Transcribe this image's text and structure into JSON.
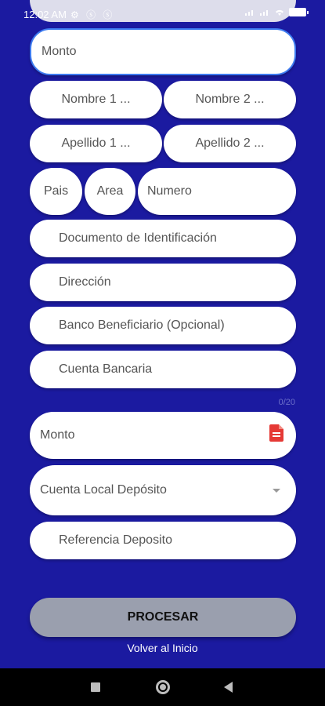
{
  "status_bar": {
    "time": "12:02 AM",
    "left_icons": "⚙ ⓢ ⓢ"
  },
  "form": {
    "monto_top": "Monto",
    "nombre1": "Nombre 1 ...",
    "nombre2": "Nombre 2 ...",
    "apellido1": "Apellido 1 ...",
    "apellido2": "Apellido 2 ...",
    "pais": "Pais",
    "area": "Area",
    "numero": "Numero",
    "documento": "Documento de Identificación",
    "direccion": "Dirección",
    "banco": "Banco Beneficiario (Opcional)",
    "cuenta": "Cuenta Bancaria",
    "counter": "0/20",
    "monto": "Monto",
    "cuenta_local": "Cuenta Local Depósito",
    "referencia": "Referencia Deposito"
  },
  "actions": {
    "procesar": "PROCESAR",
    "volver": "Volver al Inicio"
  },
  "colors": {
    "background": "#1b1aa0",
    "button": "#9a9fae",
    "pdf_icon": "#e53935"
  }
}
